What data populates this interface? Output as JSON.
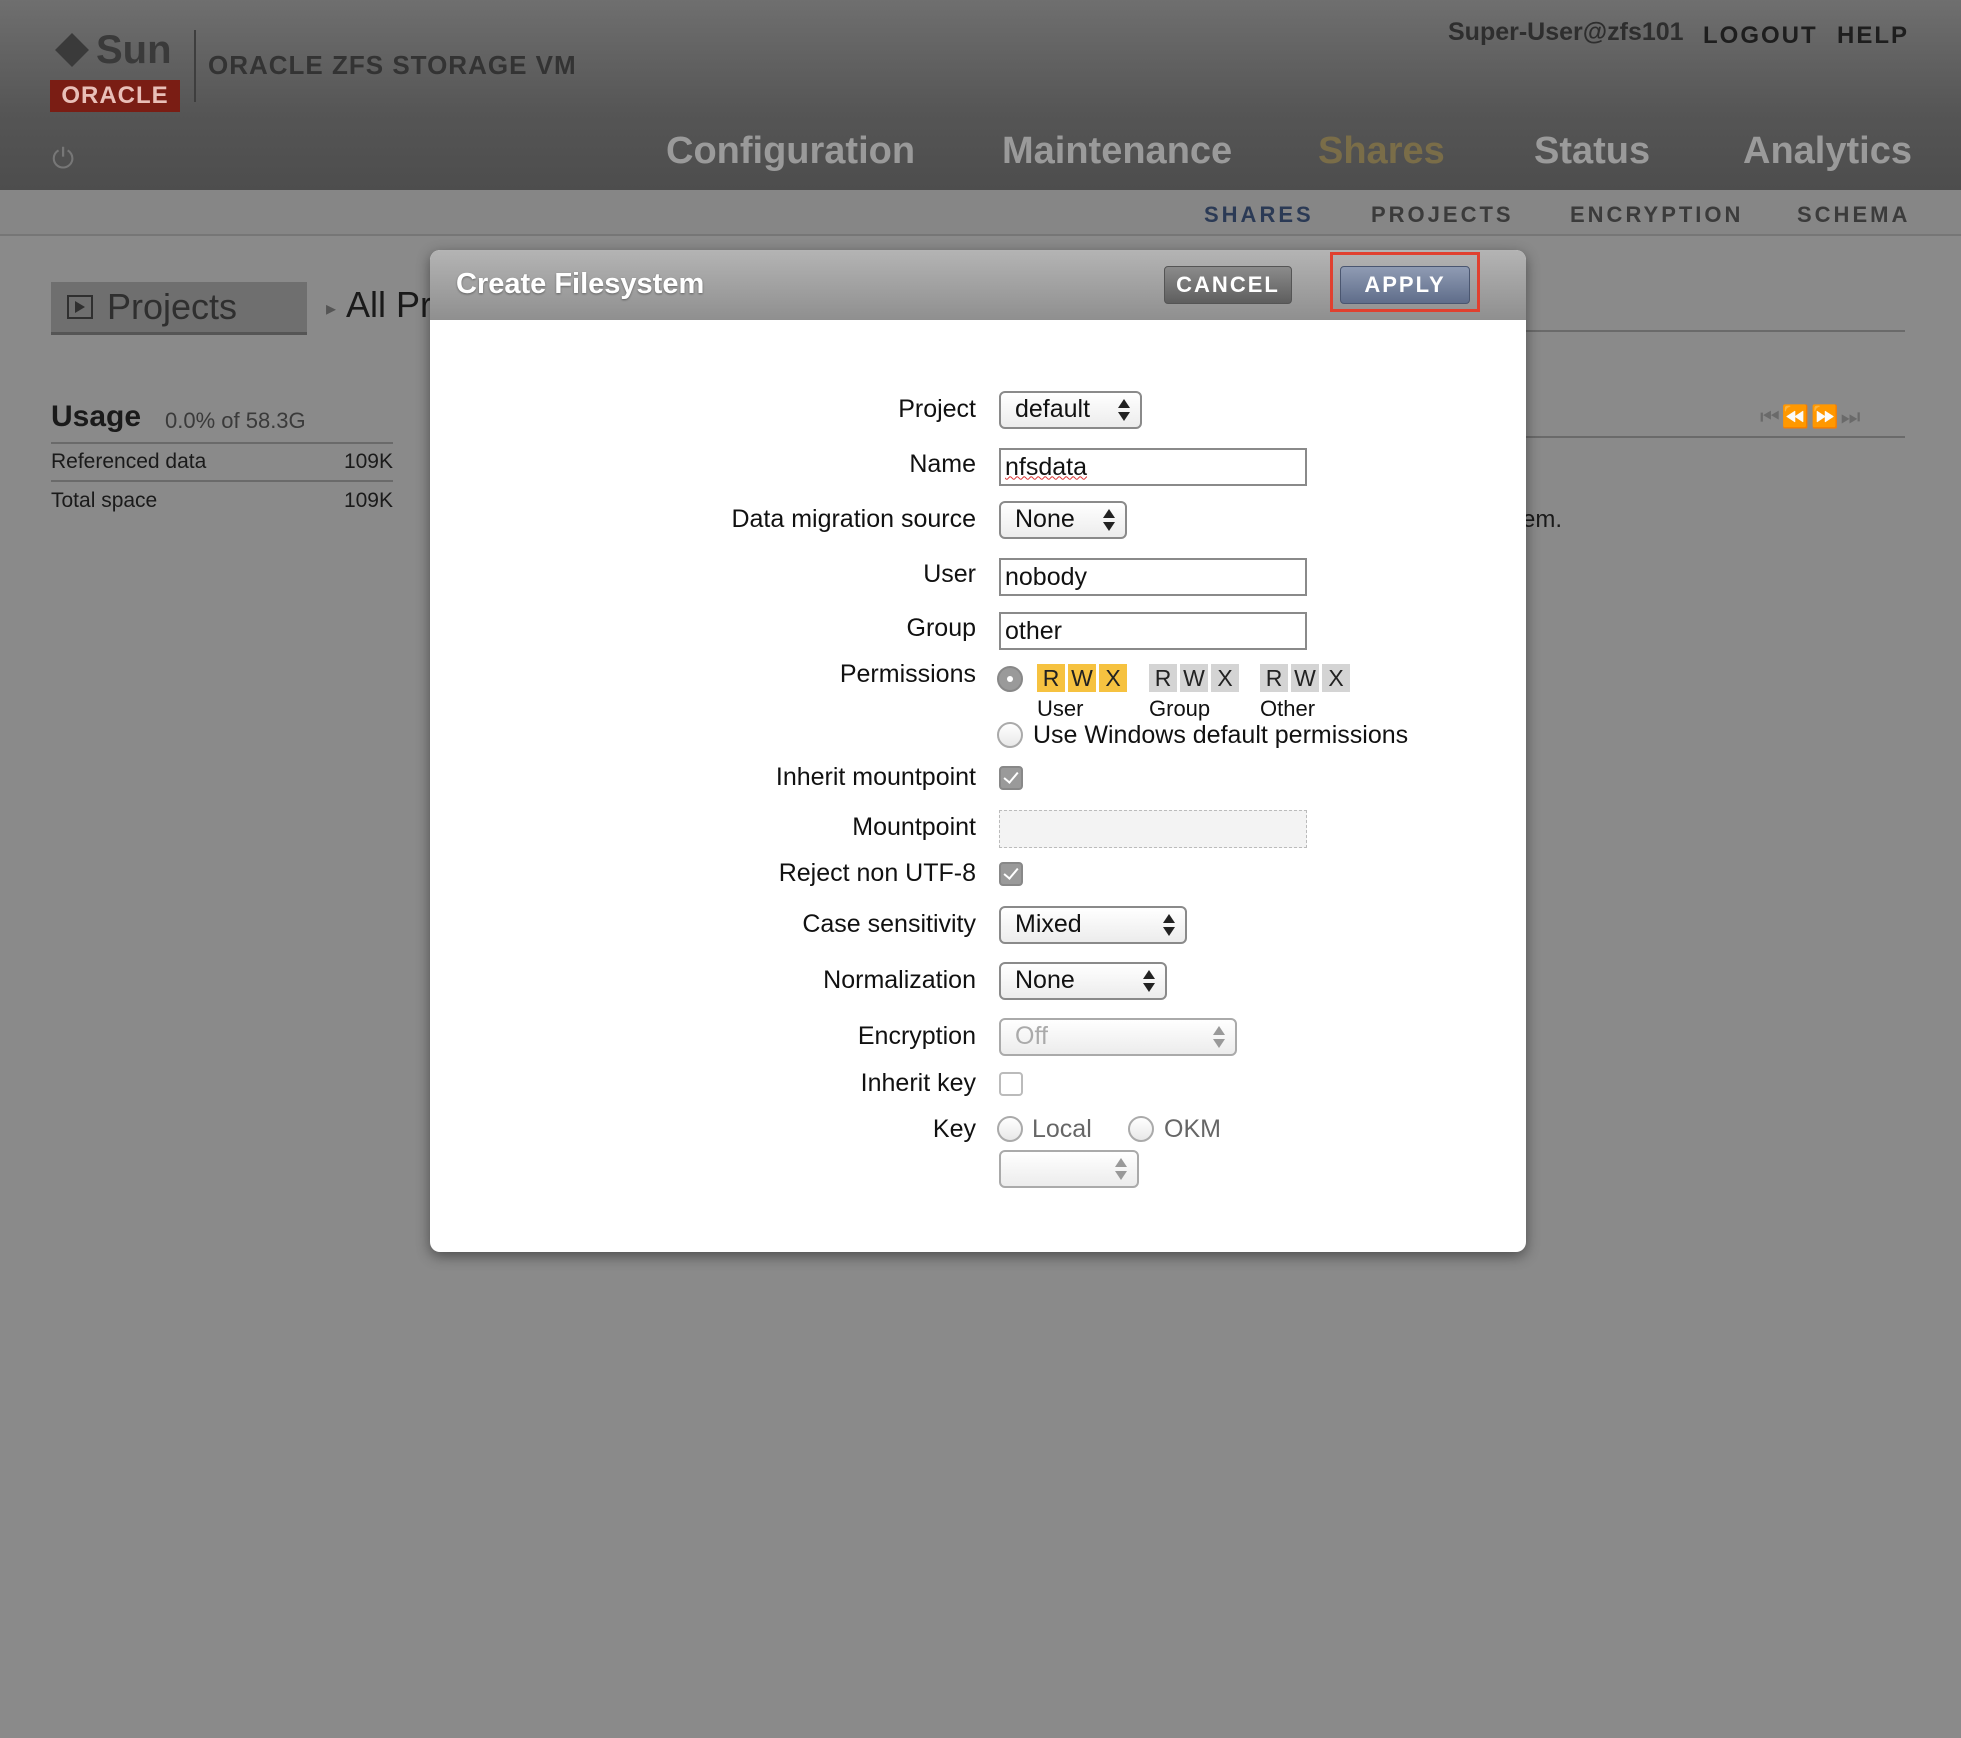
{
  "header": {
    "brand_sun": "Sun",
    "brand_oracle": "ORACLE",
    "product_name": "ORACLE ZFS STORAGE VM",
    "user": "Super-User@zfs101",
    "logout_label": "LOGOUT",
    "help_label": "HELP",
    "power_icon": "⏻",
    "main_tabs": [
      {
        "label": "Configuration"
      },
      {
        "label": "Maintenance"
      },
      {
        "label": "Shares"
      },
      {
        "label": "Status"
      },
      {
        "label": "Analytics"
      }
    ],
    "active_tab": "Shares",
    "active_color": "#7a6d48",
    "sub_tabs": [
      {
        "label": "SHARES"
      },
      {
        "label": "PROJECTS"
      },
      {
        "label": "ENCRYPTION"
      },
      {
        "label": "SCHEMA"
      }
    ],
    "active_sub_tab": "SHARES"
  },
  "background": {
    "projects_button": "Projects",
    "breadcrumb_arrow": "▸",
    "breadcrumb_all": "All Pr",
    "usage": {
      "title": "Usage",
      "percent_text": "0.0% of 58.3G",
      "rows": [
        {
          "label": "Referenced data",
          "value": "109K"
        },
        {
          "label": "Total space",
          "value": "109K"
        }
      ]
    },
    "pager_glyphs": "⏮⏪⏩⏭",
    "message_fragment": "em."
  },
  "modal": {
    "title": "Create Filesystem",
    "cancel_label": "CANCEL",
    "apply_label": "APPLY",
    "highlight_color": "#e0402f",
    "fields": {
      "project": {
        "label": "Project",
        "value": "default"
      },
      "name": {
        "label": "Name",
        "value": "nfsdata"
      },
      "migration": {
        "label": "Data migration source",
        "value": "None"
      },
      "user": {
        "label": "User",
        "value": "nobody"
      },
      "group": {
        "label": "Group",
        "value": "other"
      },
      "permissions": {
        "label": "Permissions",
        "groups": [
          {
            "name": "User",
            "bits": [
              {
                "l": "R",
                "on": true
              },
              {
                "l": "W",
                "on": true
              },
              {
                "l": "X",
                "on": true
              }
            ]
          },
          {
            "name": "Group",
            "bits": [
              {
                "l": "R",
                "on": false
              },
              {
                "l": "W",
                "on": false
              },
              {
                "l": "X",
                "on": false
              }
            ]
          },
          {
            "name": "Other",
            "bits": [
              {
                "l": "R",
                "on": false
              },
              {
                "l": "W",
                "on": false
              },
              {
                "l": "X",
                "on": false
              }
            ]
          }
        ],
        "windows_option": "Use Windows default permissions"
      },
      "inherit_mountpoint": {
        "label": "Inherit mountpoint",
        "checked": true
      },
      "mountpoint": {
        "label": "Mountpoint",
        "value": ""
      },
      "reject_utf8": {
        "label": "Reject non UTF-8",
        "checked": true
      },
      "case_sensitivity": {
        "label": "Case sensitivity",
        "value": "Mixed"
      },
      "normalization": {
        "label": "Normalization",
        "value": "None"
      },
      "encryption": {
        "label": "Encryption",
        "value": "Off"
      },
      "inherit_key": {
        "label": "Inherit key",
        "checked": false
      },
      "key": {
        "label": "Key",
        "option_local": "Local",
        "option_okm": "OKM",
        "select_value": ""
      }
    }
  }
}
